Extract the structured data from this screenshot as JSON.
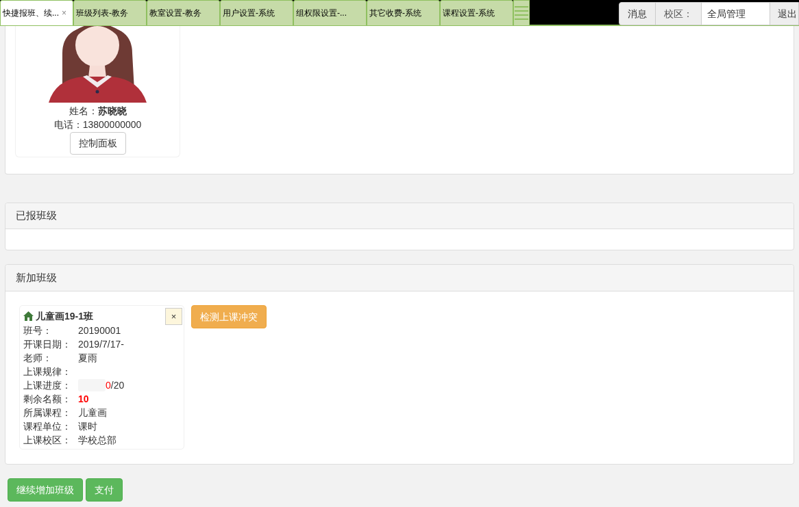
{
  "tabs": [
    {
      "label": "快捷报班、续...",
      "selected": true,
      "close": "×"
    },
    {
      "label": "班级列表-教务",
      "selected": false
    },
    {
      "label": "教室设置-教务",
      "selected": false
    },
    {
      "label": "用户设置-系统",
      "selected": false
    },
    {
      "label": "组权限设置-...",
      "selected": false
    },
    {
      "label": "其它收费-系统",
      "selected": false
    },
    {
      "label": "课程设置-系统",
      "selected": false
    }
  ],
  "top_right": {
    "messages": "消息",
    "campus_label": "校区：",
    "campus_value": "全局管理",
    "logout": "退出"
  },
  "student": {
    "name_label": "姓名：",
    "name": "苏晓晓",
    "phone_label": "电话：",
    "phone": "13800000000",
    "control_panel": "控制面板"
  },
  "enrolled": {
    "title": "已报班级"
  },
  "new_classes": {
    "title": "新加班级",
    "check_button": "检测上课冲突",
    "class_card": {
      "title": "儿童画19-1班",
      "close": "×",
      "fields": [
        {
          "kind": "text",
          "label": "班号：",
          "value": "20190001"
        },
        {
          "kind": "text",
          "label": "开课日期：",
          "value": "2019/7/17-"
        },
        {
          "kind": "text",
          "label": "老师：",
          "value": "夏雨"
        },
        {
          "kind": "text",
          "label": "上课规律："
        },
        {
          "kind": "progress",
          "label": "上课进度：",
          "level": 0,
          "done": "0",
          "total": "/20"
        },
        {
          "kind": "highlight",
          "label": "剩余名额：",
          "value": "10"
        },
        {
          "kind": "text",
          "label": "所属课程：",
          "value": "儿童画"
        },
        {
          "kind": "text",
          "label": "课程单位：",
          "value": "课时"
        },
        {
          "kind": "text",
          "label": "上课校区：",
          "value": "学校总部"
        }
      ]
    }
  },
  "actions": [
    "继续增加班级",
    "支付"
  ]
}
